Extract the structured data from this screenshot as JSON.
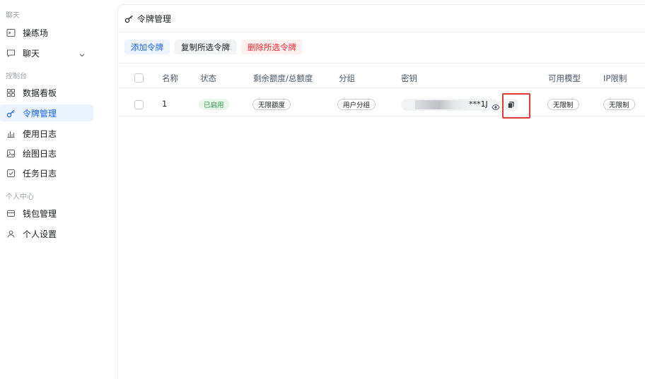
{
  "sidebar": {
    "sections": [
      {
        "label": "聊天"
      },
      {
        "label": "控制台"
      },
      {
        "label": "个人中心"
      }
    ],
    "items": [
      {
        "label": "操练场",
        "icon": "terminal-icon"
      },
      {
        "label": "聊天",
        "icon": "chat-bubble-icon"
      },
      {
        "label": "数据看板",
        "icon": "dashboard-grid-icon"
      },
      {
        "label": "令牌管理",
        "icon": "key-icon",
        "active": true
      },
      {
        "label": "使用日志",
        "icon": "bar-chart-icon"
      },
      {
        "label": "绘图日志",
        "icon": "image-icon"
      },
      {
        "label": "任务日志",
        "icon": "checkbox-icon"
      },
      {
        "label": "钱包管理",
        "icon": "wallet-icon"
      },
      {
        "label": "个人设置",
        "icon": "user-icon"
      }
    ]
  },
  "header": {
    "title": "令牌管理",
    "icon": "key-icon"
  },
  "toolbar": {
    "add_label": "添加令牌",
    "copy_label": "复制所选令牌",
    "delete_label": "删除所选令牌"
  },
  "table": {
    "columns": [
      "名称",
      "状态",
      "剩余额度/总额度",
      "分组",
      "密钥",
      "可用模型",
      "IP限制"
    ],
    "rows": [
      {
        "name": "1",
        "status": "已启用",
        "quota": "无限额度",
        "group": "用户分组",
        "key_suffix": "***1J",
        "models": "无限制",
        "ip_limit": "无限制"
      }
    ]
  },
  "colors": {
    "accent": "#1664ff",
    "danger": "#f5222d",
    "success": "#2e9a45",
    "highlight_box": "#e53935"
  }
}
